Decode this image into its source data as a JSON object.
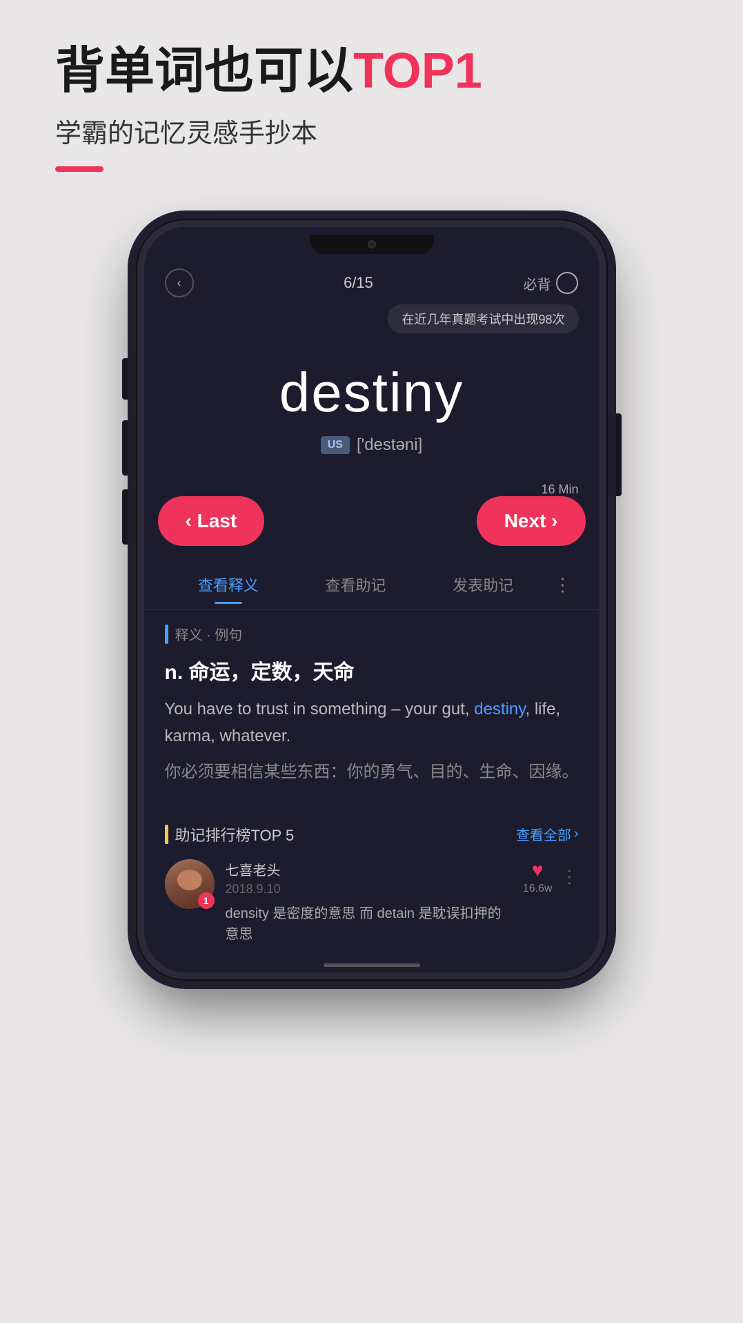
{
  "hero": {
    "title_normal": "背单词也可以",
    "title_highlight": "TOP1",
    "subtitle": "学霸的记忆灵感手抄本",
    "accent_color": "#f0335a"
  },
  "phone": {
    "topbar": {
      "back_icon": "‹",
      "progress": "6/15",
      "must_memorize": "必背"
    },
    "tooltip": "在近几年真题考试中出现98次",
    "word": {
      "text": "destiny",
      "us_label": "US",
      "phonetic": "['destəni]"
    },
    "nav": {
      "min_label": "16 Min",
      "btn_last": "‹ Last",
      "btn_next": "Next ›"
    },
    "tabs": [
      {
        "label": "查看释义",
        "active": true
      },
      {
        "label": "查看助记",
        "active": false
      },
      {
        "label": "发表助记",
        "active": false
      }
    ],
    "tabs_more": "⋮",
    "definition": {
      "section_label": "释义 · 例句",
      "pos_meaning": "n.  命运，定数，天命",
      "example_en": "You have to trust in something – your gut, destiny, life, karma, whatever.",
      "example_highlight": "destiny",
      "example_zh": "你必须要相信某些东西：你的勇气、目的、生命、因缘。"
    },
    "ranking": {
      "section_label": "助记排行榜TOP 5",
      "view_all": "查看全部",
      "user": {
        "name": "七喜老头",
        "date": "2018.9.10",
        "badge": "1",
        "content": "density 是密度的意思  而 detain 是耽误扣押的意思",
        "heart_count": "16.6w"
      }
    }
  }
}
